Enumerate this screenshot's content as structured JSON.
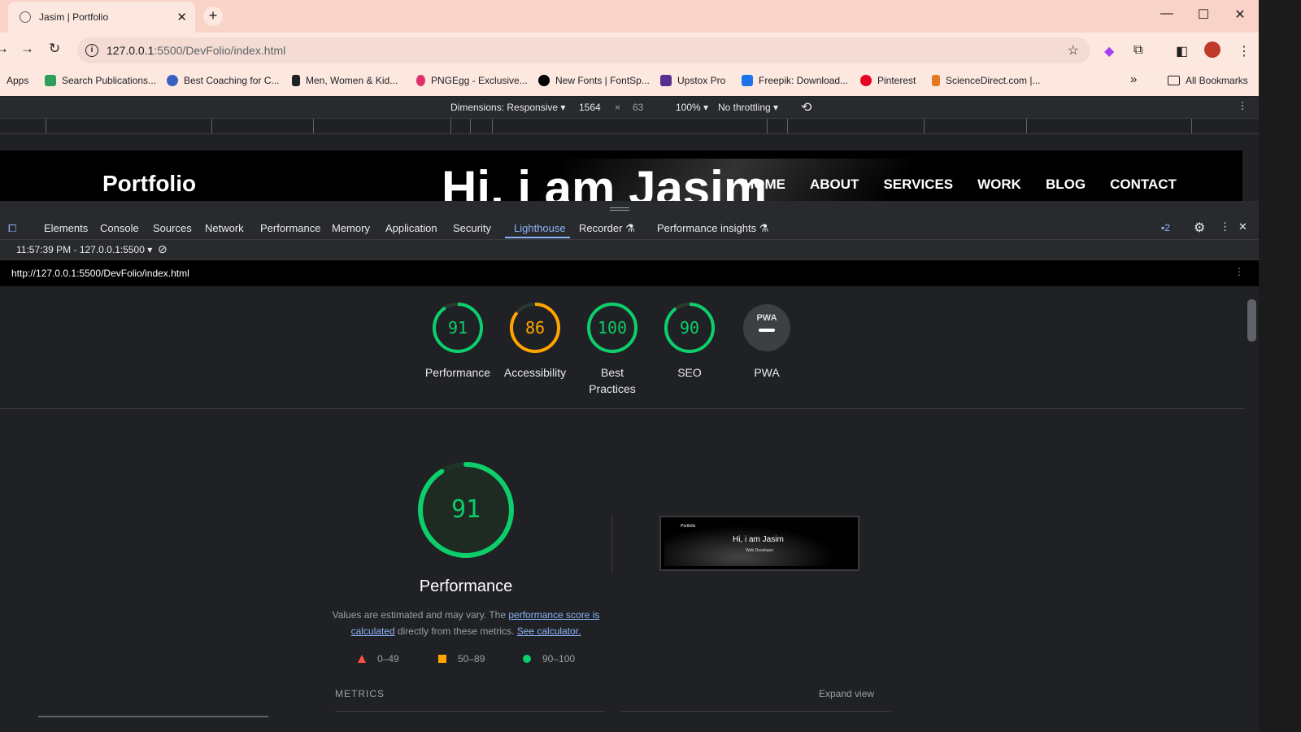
{
  "browser": {
    "tab_title": "Jasim | Portfolio",
    "tab_close": "✕",
    "new_tab": "+",
    "url_host": "127.0.0.1",
    "url_path": ":5500/DevFolio/index.html"
  },
  "bookmarks": [
    {
      "label": "Apps",
      "color": "#5f6368"
    },
    {
      "label": "Search Publications...",
      "color": "#2e9e5b"
    },
    {
      "label": "Best Coaching for C...",
      "color": "#3b5fc0"
    },
    {
      "label": "Men, Women & Kid...",
      "color": "#202124"
    },
    {
      "label": "PNGEgg - Exclusive...",
      "color": "#e0306b"
    },
    {
      "label": "New Fonts | FontSp...",
      "color": "#000000"
    },
    {
      "label": "Upstox Pro",
      "color": "#5a2d91"
    },
    {
      "label": "Freepik: Download...",
      "color": "#1a73e8"
    },
    {
      "label": "Pinterest",
      "color": "#e60023"
    },
    {
      "label": "ScienceDirect.com |...",
      "color": "#e87722"
    }
  ],
  "bookmarks_more": "»",
  "bookmarks_all": "All Bookmarks",
  "device_toolbar": {
    "dimensions": "Dimensions: Responsive ▾",
    "width": "1564",
    "times": "×",
    "height": "63",
    "zoom": "100% ▾",
    "throttling": "No throttling ▾"
  },
  "site": {
    "brand": "Portfolio",
    "hero": "Hi, i am Jasim",
    "nav": [
      "HOME",
      "ABOUT",
      "SERVICES",
      "WORK",
      "BLOG",
      "CONTACT"
    ]
  },
  "devtools": {
    "tabs": [
      "Elements",
      "Console",
      "Sources",
      "Network",
      "Performance",
      "Memory",
      "Application",
      "Security",
      "Lighthouse",
      "Recorder ⚗",
      "Performance insights ⚗"
    ],
    "issues_count": "2",
    "report_selector": "11:57:39 PM - 127.0.0.1:5500 ▾",
    "report_url": "http://127.0.0.1:5500/DevFolio/index.html"
  },
  "scores": [
    {
      "label": "Performance",
      "value": "91",
      "score": 91,
      "color": "#0cce6b"
    },
    {
      "label": "Accessibility",
      "value": "86",
      "score": 86,
      "color": "#ffa400"
    },
    {
      "label": "Best Practices",
      "value": "100",
      "score": 100,
      "color": "#0cce6b"
    },
    {
      "label": "SEO",
      "value": "90",
      "score": 90,
      "color": "#0cce6b"
    },
    {
      "label": "PWA",
      "value": "PWA",
      "score": 0,
      "color": "#9aa0a6"
    }
  ],
  "performance": {
    "score": "91",
    "score_value": 91,
    "title": "Performance",
    "desc_prefix": "Values are estimated and may vary. The ",
    "desc_link1": "performance score is calculated",
    "desc_middle": " directly from these metrics. ",
    "desc_link2": "See calculator.",
    "thumb_title": "Hi, i am Jasim",
    "thumb_subtitle": "Web Developer",
    "thumb_brand": "Portfolio"
  },
  "legend": [
    {
      "range": "0–49",
      "color": "#ff4e42"
    },
    {
      "range": "50–89",
      "color": "#ffa400"
    },
    {
      "range": "90–100",
      "color": "#0cce6b"
    }
  ],
  "metrics_label": "METRICS",
  "expand_view": "Expand view"
}
